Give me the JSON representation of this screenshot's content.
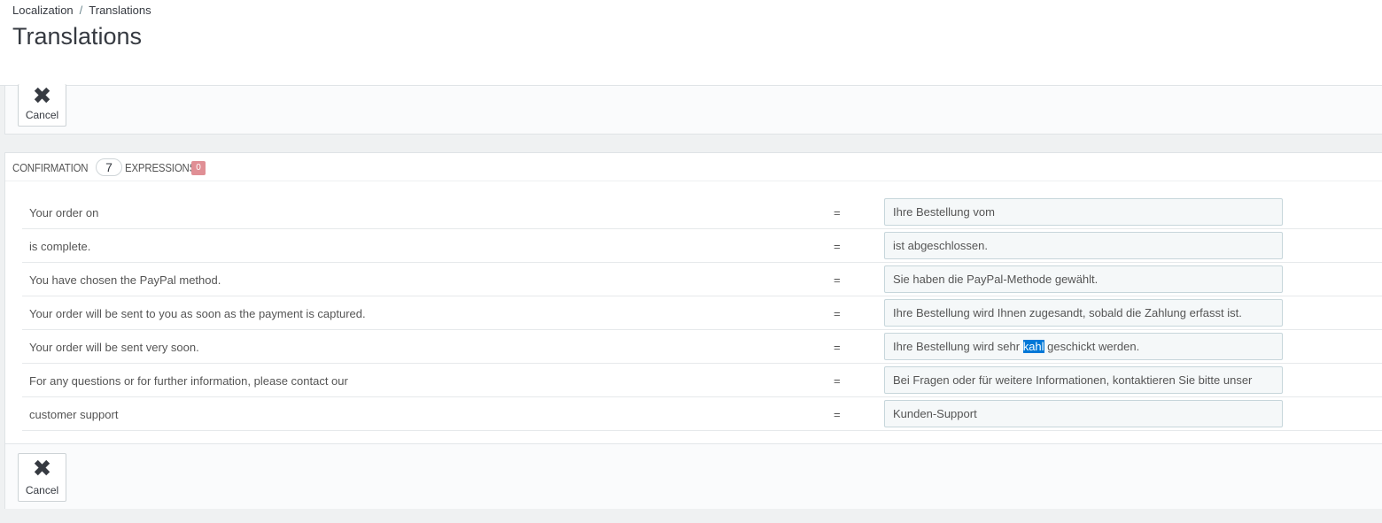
{
  "breadcrumb": {
    "parent": "Localization",
    "separator": "/",
    "current": "Translations"
  },
  "page_title": "Translations",
  "top_toolbar": {
    "cancel_icon": "close-icon",
    "cancel_label": "Cancel"
  },
  "section": {
    "title": "CONFIRMATION",
    "expression_count": "7",
    "expressions_label": "EXPRESSIONS",
    "missing_count": "0"
  },
  "rows": [
    {
      "source": "Your order on",
      "eq": "=",
      "value": "Ihre Bestellung vom"
    },
    {
      "source": "is complete.",
      "eq": "=",
      "value": "ist abgeschlossen."
    },
    {
      "source": "You have chosen the PayPal method.",
      "eq": "=",
      "value": "Sie haben die PayPal-Methode gewählt."
    },
    {
      "source": "Your order will be sent to you as soon as the payment is captured.",
      "eq": "=",
      "value": "Ihre Bestellung wird Ihnen zugesandt, sobald die Zahlung erfasst ist."
    },
    {
      "source": "Your order will be sent very soon.",
      "eq": "=",
      "value_before": "Ihre Bestellung wird sehr ",
      "value_selected": "kahl",
      "value_after": " geschickt werden."
    },
    {
      "source": "For any questions or for further information, please contact our",
      "eq": "=",
      "value": "Bei Fragen oder für weitere Informationen, kontaktieren Sie bitte unser"
    },
    {
      "source": "customer support",
      "eq": "=",
      "value": "Kunden-Support"
    }
  ],
  "bottom_toolbar": {
    "cancel_icon": "close-icon",
    "cancel_label": "Cancel"
  },
  "colors": {
    "missing_badge": "#e08f95",
    "selection": "#0078d7",
    "input_bg": "#f5f8f9"
  }
}
